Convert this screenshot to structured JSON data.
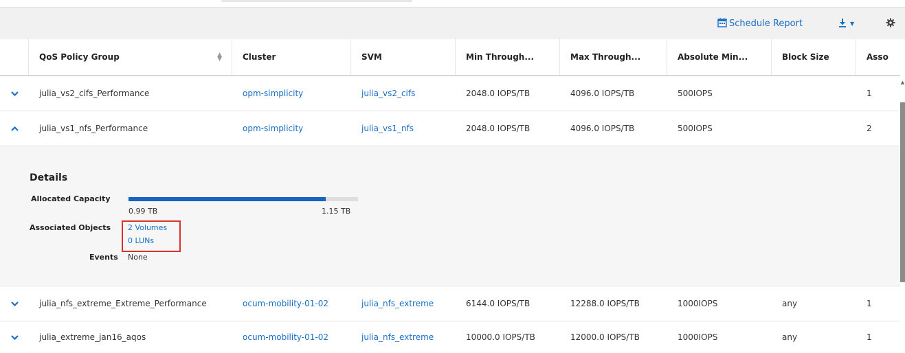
{
  "toolbar": {
    "schedule_report": "Schedule Report"
  },
  "icons": {
    "calendar": "calendar-icon",
    "download": "download-icon",
    "gear": "gear-icon",
    "chevron_down": "chevron-down-icon",
    "chevron_up": "chevron-up-icon"
  },
  "colors": {
    "link": "#1a6fc9",
    "bar_fill": "#1565c0",
    "highlight_box": "#d9342b"
  },
  "table": {
    "headers": [
      "QoS Policy Group",
      "Cluster",
      "SVM",
      "Min Through...",
      "Max Through...",
      "Absolute Min...",
      "Block Size",
      "Asso"
    ],
    "rows": [
      {
        "name": "julia_vs2_cifs_Performance",
        "cluster": "opm-simplicity",
        "svm": "julia_vs2_cifs",
        "min": "2048.0 IOPS/TB",
        "max": "4096.0 IOPS/TB",
        "abs_min": "500IOPS",
        "block": "",
        "assoc": "1"
      },
      {
        "name": "julia_vs1_nfs_Performance",
        "cluster": "opm-simplicity",
        "svm": "julia_vs1_nfs",
        "min": "2048.0 IOPS/TB",
        "max": "4096.0 IOPS/TB",
        "abs_min": "500IOPS",
        "block": "",
        "assoc": "2"
      },
      {
        "name": "julia_nfs_extreme_Extreme_Performance",
        "cluster": "ocum-mobility-01-02",
        "svm": "julia_nfs_extreme",
        "min": "6144.0 IOPS/TB",
        "max": "12288.0 IOPS/TB",
        "abs_min": "1000IOPS",
        "block": "any",
        "assoc": "1"
      },
      {
        "name": "julia_extreme_jan16_aqos",
        "cluster": "ocum-mobility-01-02",
        "svm": "julia_nfs_extreme",
        "min": "10000.0 IOPS/TB",
        "max": "12000.0 IOPS/TB",
        "abs_min": "1000IOPS",
        "block": "any",
        "assoc": "1"
      }
    ]
  },
  "details": {
    "title": "Details",
    "allocated_label": "Allocated Capacity",
    "allocated_used": "0.99 TB",
    "allocated_total": "1.15 TB",
    "allocated_fraction": 0.86,
    "associated_label": "Associated Objects",
    "volumes": "2 Volumes",
    "luns": "0 LUNs",
    "events_label": "Events",
    "events_value": "None"
  }
}
